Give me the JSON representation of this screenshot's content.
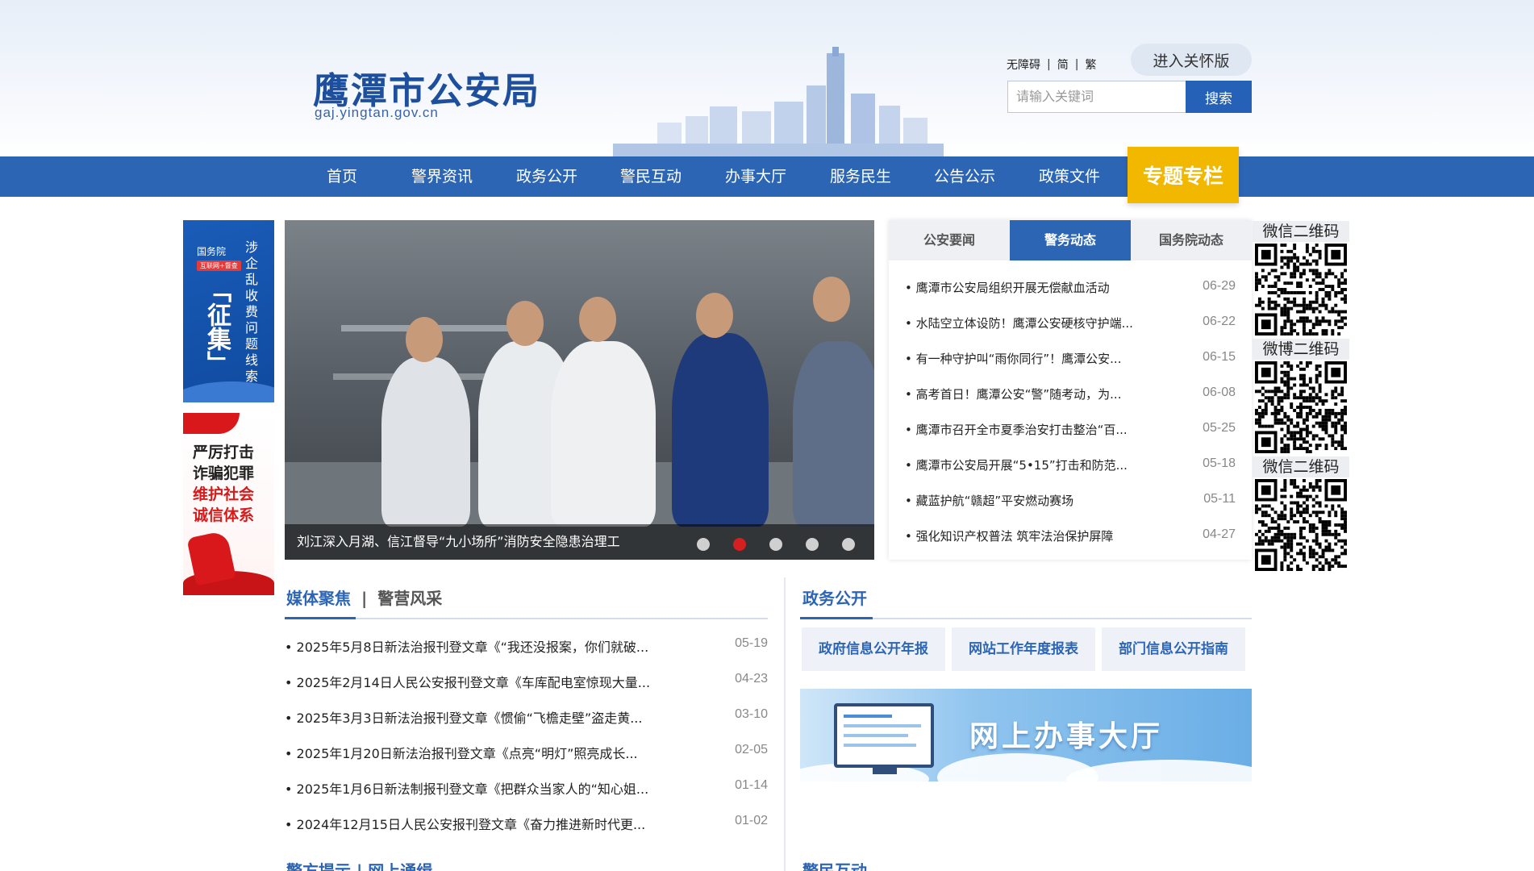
{
  "header": {
    "title": "鹰潭市公安局",
    "domain": "gaj.yingtan.gov.cn",
    "accessibility": "无障碍",
    "simplified": "简",
    "traditional": "繁",
    "care_mode": "进入关怀版",
    "search_placeholder": "请输入关键词",
    "search_button": "搜索"
  },
  "nav": {
    "items": [
      "首页",
      "警界资讯",
      "政务公开",
      "警民互动",
      "办事大厅",
      "服务民生",
      "公告公示",
      "政策文件"
    ],
    "special": "专题专栏"
  },
  "banners": {
    "b1_small": "国务院",
    "b1_tag": "互联网+督查",
    "b1_big": "「征集」",
    "b1_vertical": "涉企乱收费问题线索",
    "b2_line1": "严厉打击",
    "b2_line2": "诈骗犯罪",
    "b2_line3": "维护社会",
    "b2_line4": "诚信体系"
  },
  "slider": {
    "caption": "刘江深入月湖、信江督导“九小场所”消防安全隐患治理工",
    "slides": 5,
    "active_index": 1
  },
  "news": {
    "tabs": [
      "公安要闻",
      "警务动态",
      "国务院动态"
    ],
    "active_tab": 1,
    "items": [
      {
        "title": "鹰潭市公安局组织开展无偿献血活动",
        "date": "06-29"
      },
      {
        "title": "水陆空立体设防！鹰潭公安硬核守护端...",
        "date": "06-22"
      },
      {
        "title": "有一种守护叫“雨你同行”！鹰潭公安...",
        "date": "06-15"
      },
      {
        "title": "高考首日！鹰潭公安“警”随考动，为...",
        "date": "06-08"
      },
      {
        "title": "鹰潭市召开全市夏季治安打击整治“百...",
        "date": "05-25"
      },
      {
        "title": "鹰潭市公安局开展“5•15”打击和防范...",
        "date": "05-18"
      },
      {
        "title": "藏蓝护航“赣超”平安燃动赛场",
        "date": "05-11"
      },
      {
        "title": "强化知识产权普法 筑牢法治保护屏障",
        "date": "04-27"
      }
    ]
  },
  "qr": {
    "labels": [
      "微信二维码",
      "微博二维码",
      "微信二维码"
    ]
  },
  "media": {
    "tab1": "媒体聚焦",
    "sep": "|",
    "tab2": "警营风采",
    "items": [
      {
        "title": "2025年5月8日新法治报刊登文章《“我还没报案，你们就破...",
        "date": "05-19"
      },
      {
        "title": "2025年2月14日人民公安报刊登文章《车库配电室惊现大量...",
        "date": "04-23"
      },
      {
        "title": "2025年3月3日新法治报刊登文章《惯偷“飞檐走壁”盗走黄...",
        "date": "03-10"
      },
      {
        "title": "2025年1月20日新法治报刊登文章《点亮“明灯”照亮成长...",
        "date": "02-05"
      },
      {
        "title": "2025年1月6日新法制报刊登文章《把群众当家人的“知心姐...",
        "date": "01-14"
      },
      {
        "title": "2024年12月15日人民公安报刊登文章《奋力推进新时代更...",
        "date": "01-02"
      }
    ]
  },
  "gov": {
    "title": "政务公开",
    "buttons": [
      "政府信息公开年报",
      "网站工作年度报表",
      "部门信息公开指南"
    ],
    "hall": "网上办事大厅"
  },
  "bottom": {
    "left": "警方提示 | 网上通缉",
    "right": "警民互动"
  },
  "colors": {
    "primary": "#2d65b5",
    "accent": "#f2b800",
    "alert": "#d61f1f"
  }
}
